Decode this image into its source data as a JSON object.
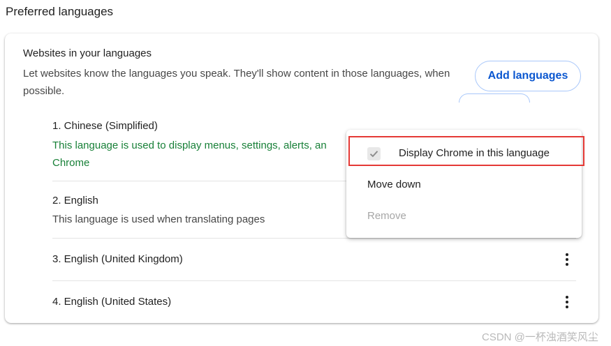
{
  "section": {
    "title": "Preferred languages"
  },
  "card": {
    "heading": "Websites in your languages",
    "description": "Let websites know the languages you speak. They'll show content in those languages, when possible.",
    "add_button": "Add languages"
  },
  "languages": [
    {
      "name": "1. Chinese (Simplified)",
      "sub_lines": [
        "This language is used to display menus, settings, alerts, an",
        "Chrome"
      ],
      "sub_color": "#188038"
    },
    {
      "name": "2. English",
      "sub": "This language is used when translating pages"
    },
    {
      "name": "3. English (United Kingdom)"
    },
    {
      "name": "4. English (United States)"
    }
  ],
  "menu": {
    "items": [
      {
        "label": "Display Chrome in this language",
        "checked": true,
        "state": "highlighted"
      },
      {
        "label": "Move down",
        "state": "enabled"
      },
      {
        "label": "Remove",
        "state": "disabled"
      }
    ]
  },
  "icons": {
    "more_actions": "more-vert-icon",
    "check": "check-icon"
  },
  "colors": {
    "accent": "#0b57d0",
    "green_text": "#188038",
    "disabled_text": "#a6a6a6",
    "highlight_border": "#e53935"
  },
  "watermark": "CSDN @一杯浊酒笑风尘"
}
